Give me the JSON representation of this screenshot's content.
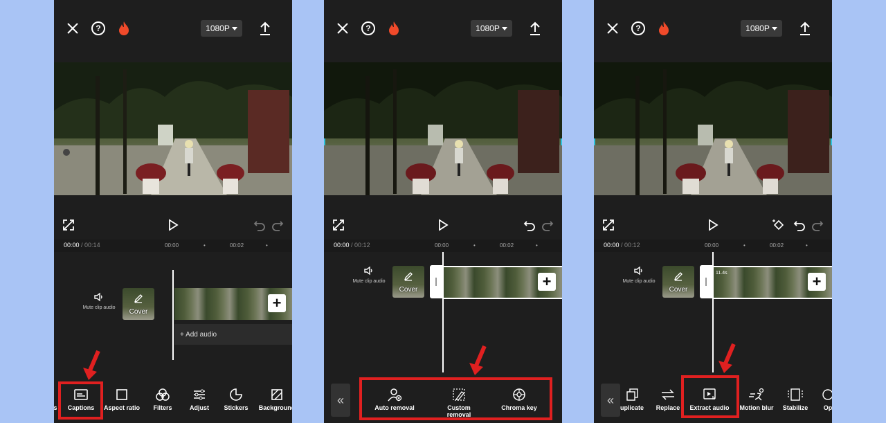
{
  "panels": [
    {
      "resolution": "1080P",
      "time_current": "00:00",
      "time_total": "/ 00:14",
      "ticks": [
        "00:00",
        "00:02"
      ],
      "mute_label": "Mute clip audio",
      "cover_label": "Cover",
      "add_audio_label": "+ Add audio",
      "tools": [
        "s",
        "Captions",
        "Aspect ratio",
        "Filters",
        "Adjust",
        "Stickers",
        "Background"
      ],
      "highlighted_tool": "Captions"
    },
    {
      "resolution": "1080P",
      "time_current": "00:00",
      "time_total": "/ 00:12",
      "ticks": [
        "00:00",
        "00:02"
      ],
      "mute_label": "Mute clip audio",
      "cover_label": "Cover",
      "tools": [
        "Auto removal",
        "Custom removal",
        "Chroma key"
      ],
      "highlighted_tool": "Auto removal, Custom removal, Chroma key"
    },
    {
      "resolution": "1080P",
      "time_current": "00:00",
      "time_total": "/ 00:12",
      "ticks": [
        "00:00",
        "00:02"
      ],
      "mute_label": "Mute clip audio",
      "cover_label": "Cover",
      "clip_duration": "11.4s",
      "tools": [
        "uplicate",
        "Replace",
        "Extract audio",
        "Motion blur",
        "Stabilize",
        "Op"
      ],
      "highlighted_tool": "Extract audio"
    }
  ],
  "colors": {
    "background": "#a9c4f5",
    "app_bg": "#1e1e1e",
    "highlight": "#e02020",
    "selection": "#2ec4e0",
    "flame": "#f04a2a"
  },
  "icons": [
    "close-icon",
    "help-icon",
    "flame-icon",
    "export-icon",
    "fullscreen-icon",
    "play-icon",
    "undo-icon",
    "redo-icon",
    "keyframe-icon",
    "speaker-icon",
    "pen-icon",
    "plus-icon",
    "chevron-double-left-icon"
  ]
}
